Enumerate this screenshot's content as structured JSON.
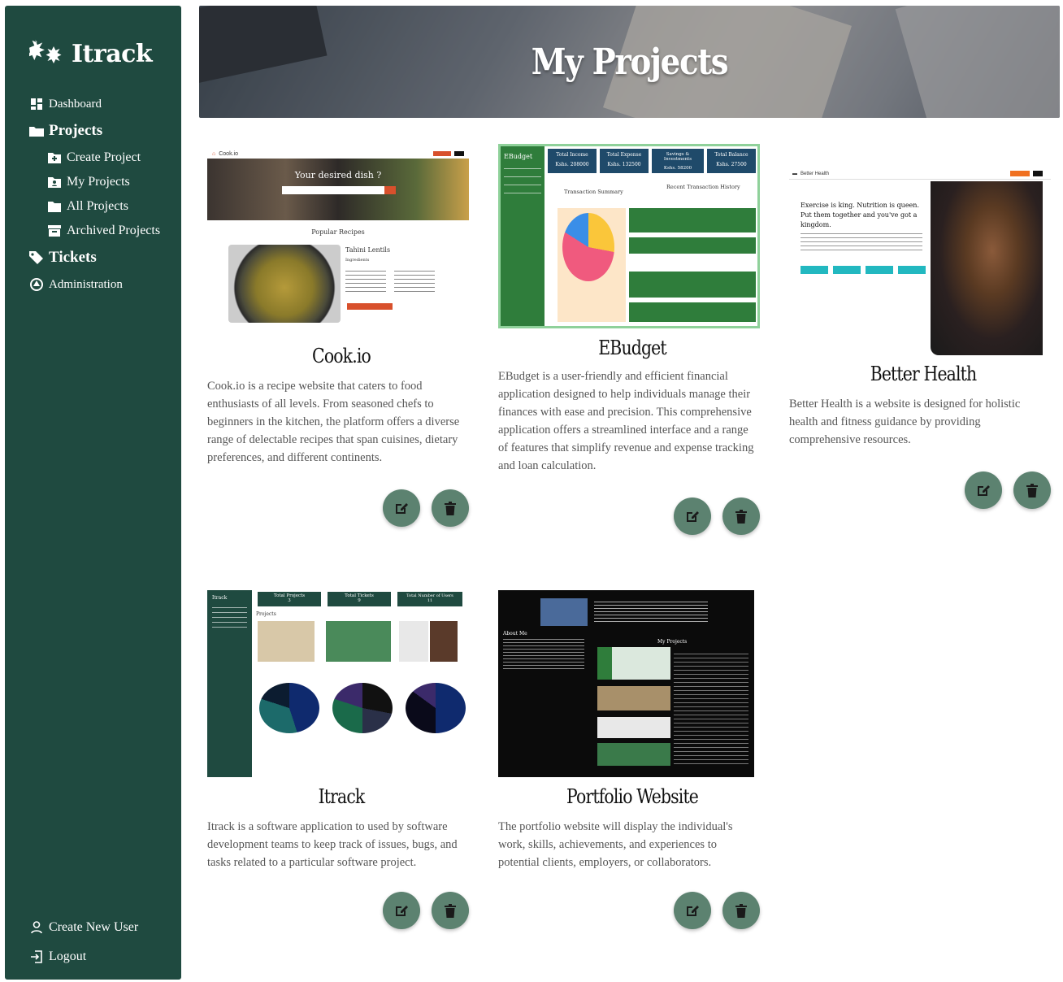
{
  "app": {
    "name": "Itrack"
  },
  "sidebar": {
    "items": [
      {
        "label": "Dashboard"
      },
      {
        "label": "Projects"
      },
      {
        "label": "Create Project"
      },
      {
        "label": "My Projects"
      },
      {
        "label": "All Projects"
      },
      {
        "label": "Archived Projects"
      },
      {
        "label": "Tickets"
      },
      {
        "label": "Administration"
      }
    ],
    "bottom": [
      {
        "label": "Create New User"
      },
      {
        "label": "Logout"
      }
    ]
  },
  "banner": {
    "title": "My Projects"
  },
  "projects": [
    {
      "title": "Cook.io",
      "description": "Cook.io is a recipe website that caters to food enthusiasts of all levels. From seasoned chefs to beginners in the kitchen, the platform offers a diverse range of delectable recipes that span cuisines, dietary preferences, and different continents.",
      "shot": {
        "brand": "Cook.io",
        "hero": "Your desired dish ?",
        "section": "Popular Recipes",
        "recipe": "Tahini Lentils",
        "ingredients": "Ingredients"
      }
    },
    {
      "title": "EBudget",
      "description": "EBudget is a user-friendly and efficient financial application designed to help individuals manage their finances with ease and precision. This comprehensive application offers a streamlined interface and a range of features that simplify revenue and expense tracking and loan calculation.",
      "shot": {
        "brand": "EBudget",
        "stat1": "Total Income",
        "val1": "Kshs. 208000",
        "stat2": "Total Expense",
        "val2": "Kshs. 132500",
        "stat3": "Savings & Investments",
        "val3": "Kshs. 58200",
        "stat4": "Total Balance",
        "val4": "Kshs. 27500",
        "summary": "Transaction Summary",
        "history": "Recent Transaction History"
      }
    },
    {
      "title": "Better Health",
      "description": "Better Health is a website is designed for holistic health and fitness guidance by providing comprehensive resources.",
      "shot": {
        "brand": "Better Health",
        "headline": "Exercise is king. Nutrition is queen. Put them together and you've got a kingdom."
      }
    },
    {
      "title": "Itrack",
      "description": "Itrack is a software application to used by software development teams to keep track of issues, bugs, and tasks related to a particular software project.",
      "shot": {
        "brand": "Itrack",
        "s1": "Total Projects",
        "v1": "3",
        "s2": "Total Tickets",
        "v2": "9",
        "s3": "Total Number of Users",
        "v3": "11",
        "projects": "Projects"
      }
    },
    {
      "title": "Portfolio Website",
      "description": "The portfolio website will display the individual's work, skills, achievements, and experiences to potential clients, employers, or collaborators.",
      "shot": {
        "heading": "My Projects",
        "about": "About Me"
      }
    }
  ],
  "colors": {
    "sidebar": "#1f4a40",
    "button": "#5c8270",
    "ebudget": "#2f7d3b",
    "better_health": "#22b8c0",
    "cook_accent": "#d8502c"
  },
  "icons": {
    "edit": "edit-icon",
    "delete": "trash-icon"
  }
}
